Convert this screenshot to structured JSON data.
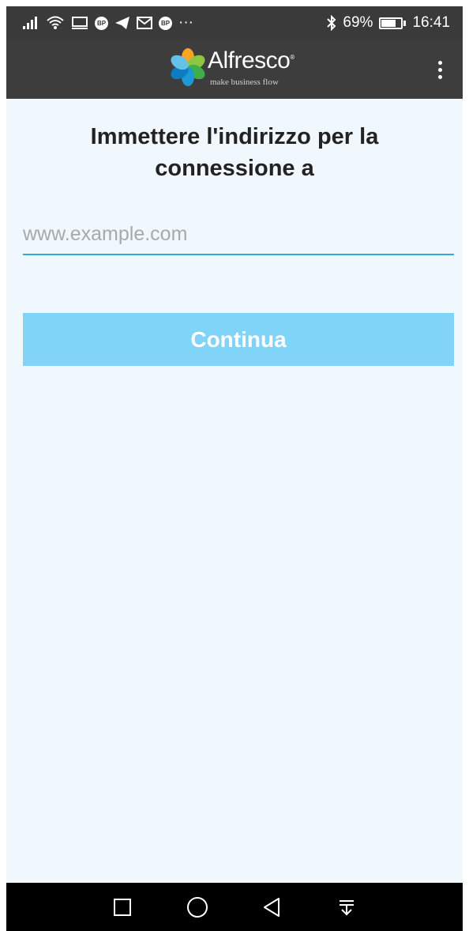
{
  "status_bar": {
    "signal_icon": "signal-icon",
    "wifi_icon": "wifi-icon",
    "cast_icon": "screen-cast-icon",
    "app_badge_1": "BP",
    "telegram_icon": "telegram-icon",
    "mail_icon": "mail-icon",
    "app_badge_2": "BP",
    "more_indicator": "···",
    "bluetooth_icon": "bluetooth-icon",
    "battery_percent": "69%",
    "battery_level": 0.69,
    "time": "16:41"
  },
  "app_bar": {
    "logo_name": "Alfresco",
    "logo_tagline": "make business flow",
    "menu_icon": "more-vert-icon"
  },
  "main": {
    "title_line1": "Immettere l'indirizzo per la",
    "title_line2": "connessione a",
    "address_input": {
      "value": "",
      "placeholder": "www.example.com"
    },
    "continue_label": "Continua"
  },
  "nav_bar": {
    "recents_icon": "square-icon",
    "home_icon": "circle-icon",
    "back_icon": "triangle-back-icon",
    "notifications_icon": "pull-down-icon"
  },
  "colors": {
    "status_bar_bg": "#3a3a3a",
    "app_bar_bg": "#3d3d3d",
    "screen_bg": "#f0f7fd",
    "input_underline": "#3aa5da",
    "button_bg": "#80d4f8",
    "nav_bar_bg": "#000000"
  }
}
